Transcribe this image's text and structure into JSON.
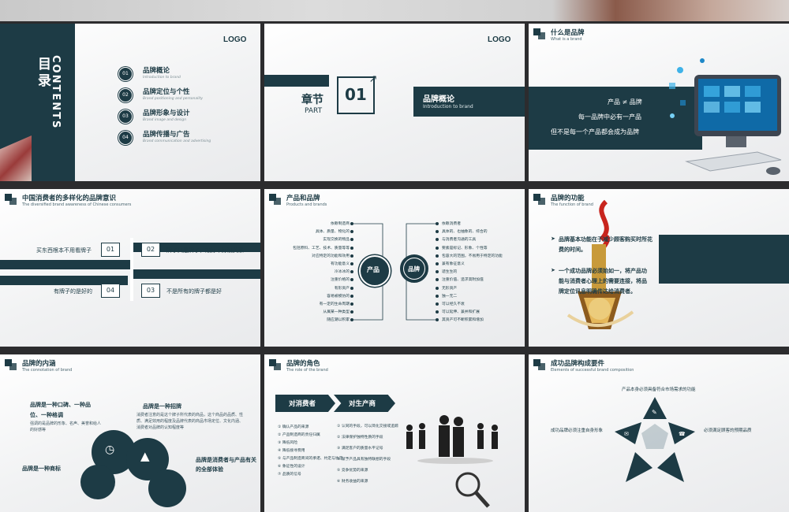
{
  "slides": {
    "toc": {
      "logo": "LOGO",
      "title_cn": "目录",
      "title_en": "CONTENTS",
      "items": [
        {
          "num": "01",
          "title": "品牌概论",
          "sub": "Introduction to brand"
        },
        {
          "num": "02",
          "title": "品牌定位与个性",
          "sub": "Brand positioning and personality"
        },
        {
          "num": "03",
          "title": "品牌形象与设计",
          "sub": "Brand image and design"
        },
        {
          "num": "04",
          "title": "品牌传播与广告",
          "sub": "Brand communication and advertising"
        }
      ]
    },
    "chapter": {
      "logo": "LOGO",
      "label_cn": "章节",
      "label_en": "PART",
      "num": "01",
      "title": "品牌概论",
      "subtitle": "Introduction to brand"
    },
    "what_brand": {
      "title": "什么是品牌",
      "subtitle": "What is a brand",
      "lines": [
        "产品 ≠ 品牌",
        "每一品牌中必有一产品",
        "但不是每一个产品都会成为品牌"
      ]
    },
    "awareness": {
      "title": "中国消费者的多样化的品牌意识",
      "subtitle": "The diversified brand awareness of Chinese consumers",
      "quads": [
        {
          "num": "01",
          "text": "买东西根本不用看牌子"
        },
        {
          "num": "02",
          "text": "牌子只是牌子，跟好不好没关系"
        },
        {
          "num": "04",
          "text": "有牌子的是好的"
        },
        {
          "num": "03",
          "text": "不是所有的牌子都是好"
        }
      ]
    },
    "product_brand": {
      "title": "产品和品牌",
      "subtitle": "Products and brands",
      "product_label": "产品",
      "brand_label": "品牌",
      "left_items": [
        "依赖制造商",
        "具体、质量、物化的",
        "实现交换的物品",
        "包括原料、工艺、技术、质量等等",
        "对应特定的功能和效用",
        "有功能意义",
        "冷冰冰的",
        "注重价格的",
        "有形资产",
        "容易被模仿的",
        "有一定的生命周期",
        "从属某一种类型",
        "随应潮以积累"
      ],
      "right_items": [
        "依赖消费者",
        "具体的、也抽象的、综合的",
        "与消费者沟通的工具",
        "要素是标记、形象、个性等",
        "包容大的范围，不易用于特定的功能",
        "兼有象征意义",
        "适生生的",
        "注重价值、追求高附加值",
        "无形资产",
        "独一无二",
        "可以经久不衰",
        "可以延伸、兼并和扩展",
        "其资产可不断积累和增加"
      ]
    },
    "function": {
      "title": "品牌的功能",
      "subtitle": "The function of brand",
      "points": [
        "品牌基本功能在于减少顾客购买时所花费的时间。",
        "一个成功品牌必须始如一，将产品功能与消费者心理上的需要连接，将品牌定位讯息明确传达给消费者。"
      ]
    },
    "connotation": {
      "title": "品牌的内涵",
      "subtitle": "The connotation of brand",
      "b1_title": "品牌是一种口碑、一种品位、一种格调",
      "b1_desc": "强调的是品牌的形象、名声、美誉和给人的好感等",
      "b2_title": "品牌是一种招牌",
      "b2_desc": "消费者注意的是这个牌子所代表的商品，这个商品的品质、性质、满足效用的程度及品牌代表的商品市场定位、文化内涵、消费者对品牌的认知程度等",
      "b3_title": "品牌是一种商标",
      "b4_title": "品牌是消费者与产品有关的全部体验"
    },
    "role": {
      "title": "品牌的角色",
      "subtitle": "The role of the brand",
      "tab1": "对消费者",
      "tab2": "对生产商",
      "consumer_items": [
        "确认产品的来源",
        "产品制造商的责任归属",
        "降低风险",
        "降低搜寻费用",
        "与产品制造商间的承诺、约定与协定",
        "象征性的设计",
        "品质的信号"
      ],
      "producer_items": [
        "认同的手段，可以简化交接或追踪",
        "法律保护独特性质的手段",
        "满足客户的质量水平记号",
        "赋予产品具有独特联想的手段",
        "竞争优势的来源",
        "财务收益的来源"
      ]
    },
    "success": {
      "title": "成功品牌构成要件",
      "subtitle": "Elements of successful brand composition",
      "top": "产品本身必须具备符合市场需求的功能",
      "left": "成功品牌必须注重自身形象",
      "right": "必须满足顾客的预期品质"
    }
  },
  "colors": {
    "primary": "#1d3b45",
    "accent": "#e03030"
  }
}
